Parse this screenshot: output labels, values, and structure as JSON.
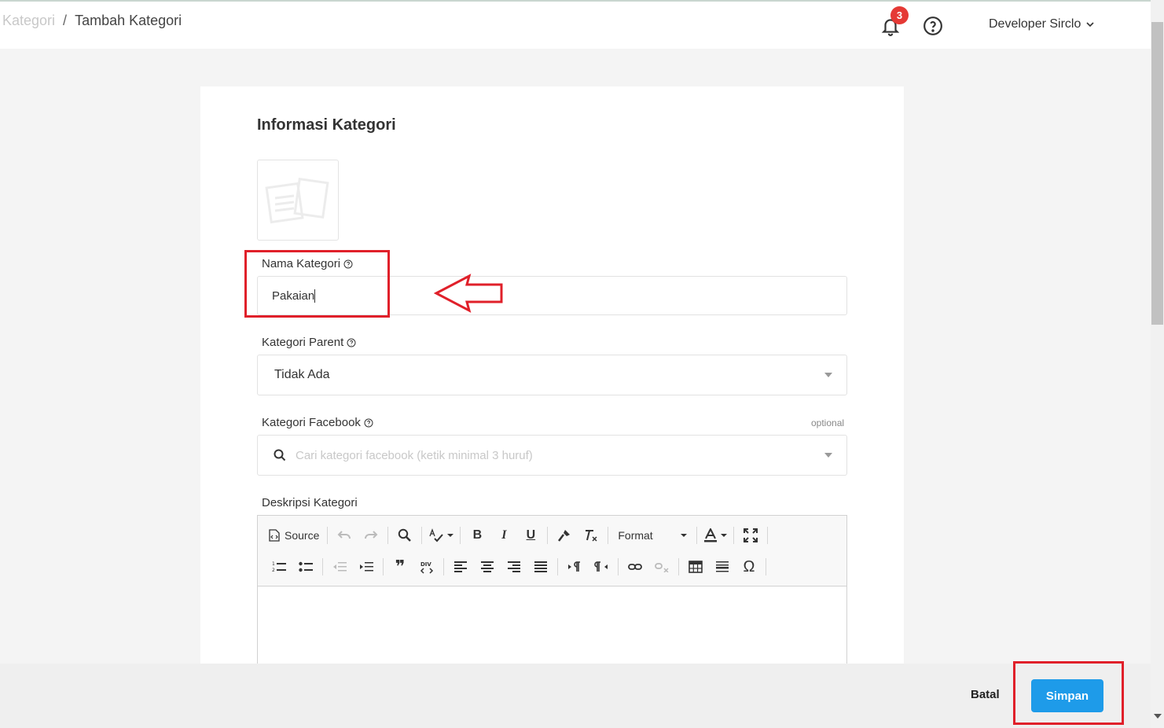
{
  "header": {
    "breadcrumb": {
      "parent": "Kategori",
      "separator": "/",
      "current": "Tambah Kategori"
    },
    "notification_count": "3",
    "user_name": "Developer Sirclo"
  },
  "form": {
    "section_title": "Informasi Kategori",
    "name": {
      "label": "Nama Kategori",
      "value": "Pakaian"
    },
    "parent": {
      "label": "Kategori Parent",
      "value": "Tidak Ada"
    },
    "facebook": {
      "label": "Kategori Facebook",
      "optional": "optional",
      "placeholder": "Cari kategori facebook (ketik minimal 3 huruf)"
    },
    "description": {
      "label": "Deskripsi Kategori"
    }
  },
  "editor_toolbar": {
    "source_label": "Source",
    "format_label": "Format",
    "bold": "B",
    "italic": "I",
    "underline": "U",
    "omega": "Ω",
    "quote": "❞"
  },
  "footer": {
    "cancel_label": "Batal",
    "save_label": "Simpan"
  },
  "colors": {
    "primary": "#1e9be9",
    "badge": "#e53935",
    "annotation": "#e0202a"
  }
}
